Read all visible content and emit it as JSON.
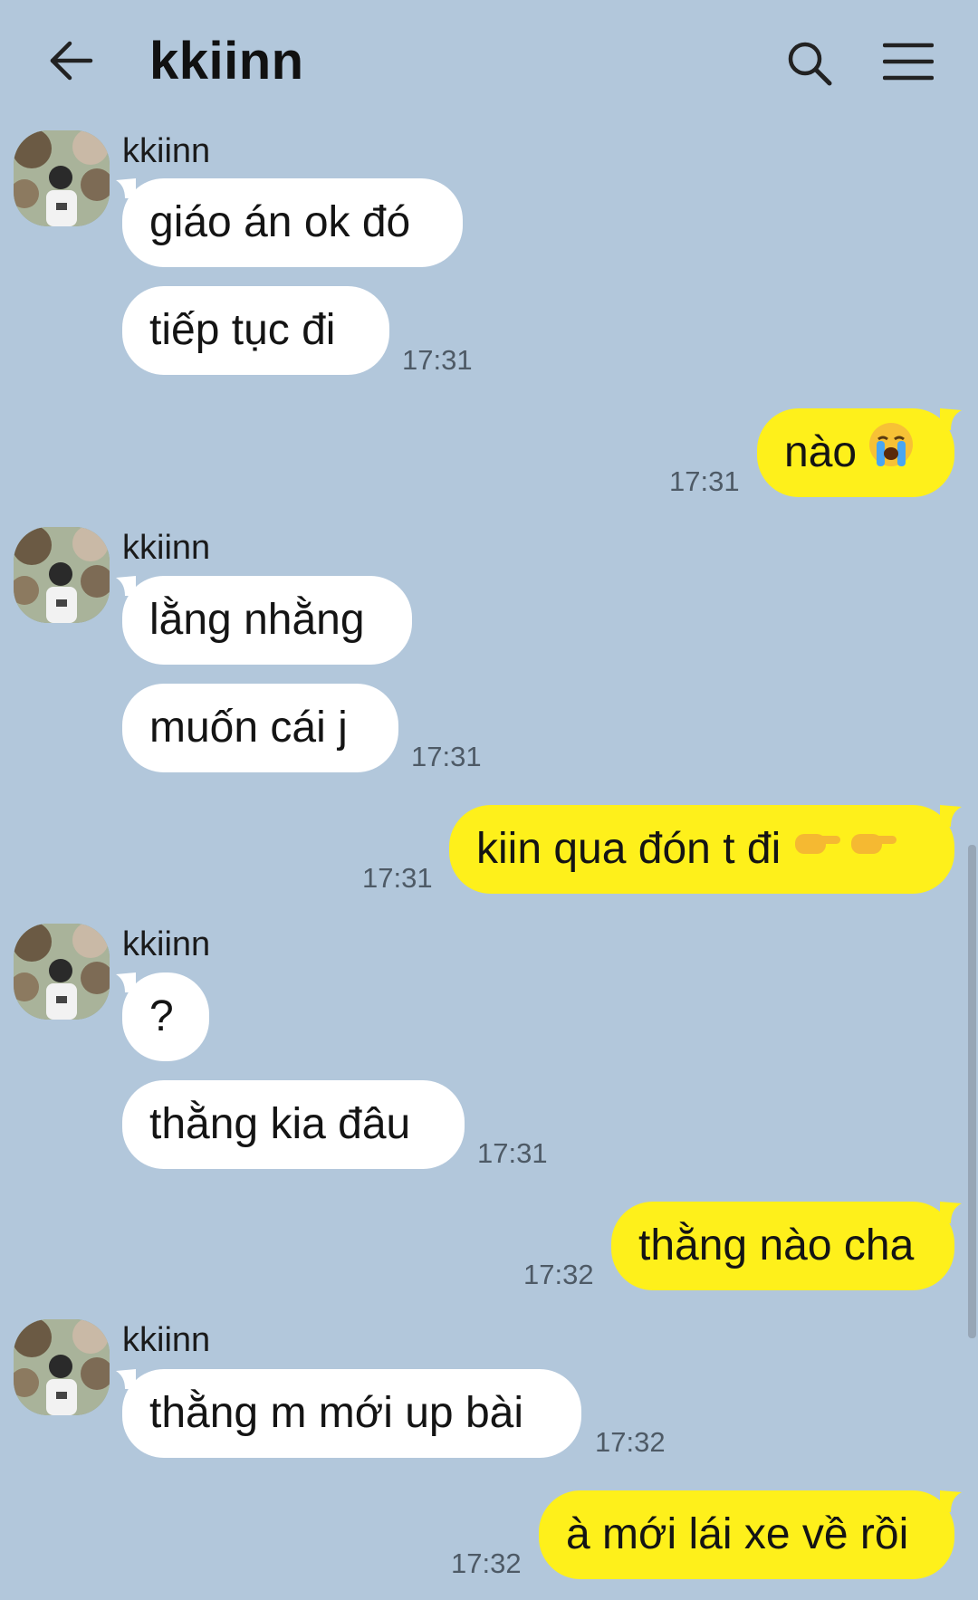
{
  "header": {
    "title": "kkiinn",
    "back_icon": "arrow-left-icon",
    "search_icon": "search-icon",
    "menu_icon": "hamburger-menu-icon"
  },
  "colors": {
    "background": "#b2c7db",
    "incoming_bubble": "#ffffff",
    "outgoing_bubble": "#fef01b"
  },
  "messages": [
    {
      "sender": "kkiinn",
      "direction": "in",
      "bubbles": [
        "giáo án ok đó",
        "tiếp tục đi"
      ],
      "time": "17:31"
    },
    {
      "direction": "out",
      "text": "nào",
      "emoji": "crying-face",
      "time": "17:31"
    },
    {
      "sender": "kkiinn",
      "direction": "in",
      "bubbles": [
        "lằng nhằng",
        "muốn cái j"
      ],
      "time": "17:31"
    },
    {
      "direction": "out",
      "text": "kiin qua đón t đi",
      "emoji": "pointing-hands",
      "time": "17:31"
    },
    {
      "sender": "kkiinn",
      "direction": "in",
      "bubbles": [
        "?",
        "thằng kia đâu"
      ],
      "time": "17:31"
    },
    {
      "direction": "out",
      "text": "thằng nào cha",
      "time": "17:32"
    },
    {
      "sender": "kkiinn",
      "direction": "in",
      "bubbles": [
        "thằng m mới up bài"
      ],
      "time": "17:32"
    },
    {
      "direction": "out",
      "text": "à mới lái xe về rồi",
      "time": "17:32"
    }
  ]
}
